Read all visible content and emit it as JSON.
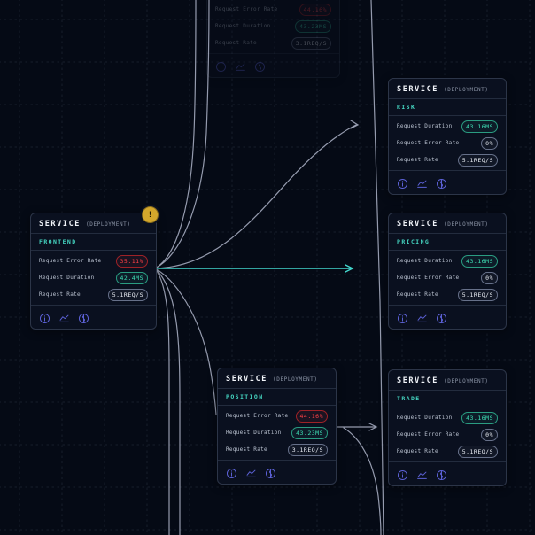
{
  "colors": {
    "background": "#050a15",
    "card_bg": "#0a101f",
    "card_border": "#2c3548",
    "accent_teal": "#45d6c2",
    "error_red": "#ff4046",
    "ok_teal_badge": "#3fe0b6",
    "neutral_badge": "#e8ecf3",
    "icon_indigo": "#5d62d8",
    "edge_gray": "#b9bfd4",
    "edge_teal": "#43d8ce",
    "warning_gold": "#d3a72c"
  },
  "warning": {
    "glyph": "!"
  },
  "cards": {
    "frontend": {
      "title": "SERVICE",
      "type": "(DEPLOYMENT)",
      "name": "FRONTEND",
      "rows": [
        {
          "label": "Request Error Rate",
          "value": "35.11%"
        },
        {
          "label": "Request Duration",
          "value": "42.4MS"
        },
        {
          "label": "Request Rate",
          "value": "5.1REQ/S"
        }
      ]
    },
    "risk": {
      "title": "SERVICE",
      "type": "(DEPLOYMENT)",
      "name": "RISK",
      "rows": [
        {
          "label": "Request Duration",
          "value": "43.16MS"
        },
        {
          "label": "Request Error Rate",
          "value": "0%"
        },
        {
          "label": "Request Rate",
          "value": "5.1REQ/S"
        }
      ]
    },
    "pricing": {
      "title": "SERVICE",
      "type": "(DEPLOYMENT)",
      "name": "PRICING",
      "rows": [
        {
          "label": "Request Duration",
          "value": "43.16MS"
        },
        {
          "label": "Request Error Rate",
          "value": "0%"
        },
        {
          "label": "Request Rate",
          "value": "5.1REQ/S"
        }
      ]
    },
    "position": {
      "title": "SERVICE",
      "type": "(DEPLOYMENT)",
      "name": "POSITION",
      "rows": [
        {
          "label": "Request Error Rate",
          "value": "44.16%"
        },
        {
          "label": "Request Duration",
          "value": "43.23MS"
        },
        {
          "label": "Request Rate",
          "value": "3.1REQ/S"
        }
      ]
    },
    "trade": {
      "title": "SERVICE",
      "type": "(DEPLOYMENT)",
      "name": "TRADE",
      "rows": [
        {
          "label": "Request Duration",
          "value": "43.16MS"
        },
        {
          "label": "Request Error Rate",
          "value": "0%"
        },
        {
          "label": "Request Rate",
          "value": "5.1REQ/S"
        }
      ]
    },
    "ghost": {
      "rows": [
        {
          "label": "Request Error Rate",
          "value": "44.16%"
        },
        {
          "label": "Request Duration",
          "value": "43.23MS"
        },
        {
          "label": "Request Rate",
          "value": "3.1REQ/S"
        }
      ]
    }
  }
}
